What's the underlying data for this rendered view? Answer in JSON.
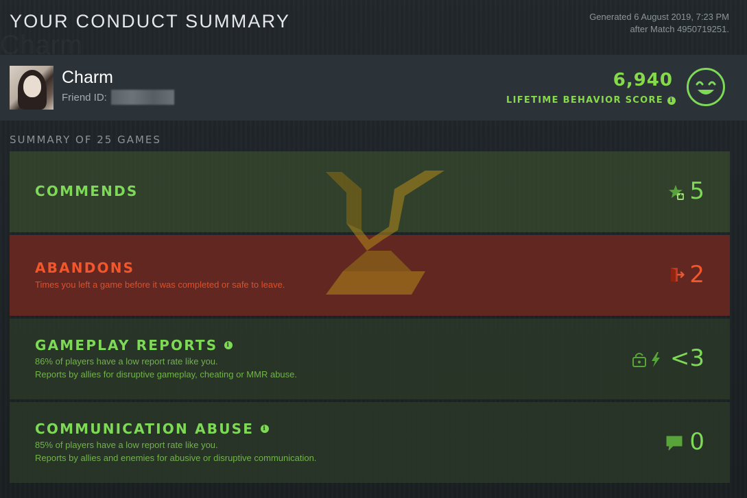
{
  "header": {
    "title": "YOUR CONDUCT SUMMARY",
    "generated_line1": "Generated 6 August 2019, 7:23 PM",
    "generated_line2": "after Match 4950719251."
  },
  "profile": {
    "name": "Charm",
    "friend_id_label": "Friend ID:",
    "score": "6,940",
    "score_label": "LIFETIME BEHAVIOR SCORE"
  },
  "summary": {
    "label": "SUMMARY OF 25 GAMES"
  },
  "panels": {
    "commends": {
      "title": "COMMENDS",
      "value": "5",
      "icon": "star-thumb-icon"
    },
    "abandons": {
      "title": "ABANDONS",
      "desc1": "Times you left a game before it was completed or safe to leave.",
      "value": "2",
      "icon": "exit-door-icon"
    },
    "reports": {
      "title": "GAMEPLAY REPORTS",
      "desc1": "86% of players have a low report rate like you.",
      "desc2": "Reports by allies for disruptive gameplay, cheating or MMR abuse.",
      "value": "<3",
      "icon": "lock-lightning-icon"
    },
    "comms": {
      "title": "COMMUNICATION ABUSE",
      "desc1": "85% of players have a low report rate like you.",
      "desc2": "Reports by allies and enemies for abusive or disruptive communication.",
      "value": "0",
      "icon": "chat-bubble-icon"
    }
  },
  "colors": {
    "positive": "#7ed957",
    "negative": "#f2562a",
    "background": "#1d2226",
    "profile_bar": "#2b3338"
  }
}
